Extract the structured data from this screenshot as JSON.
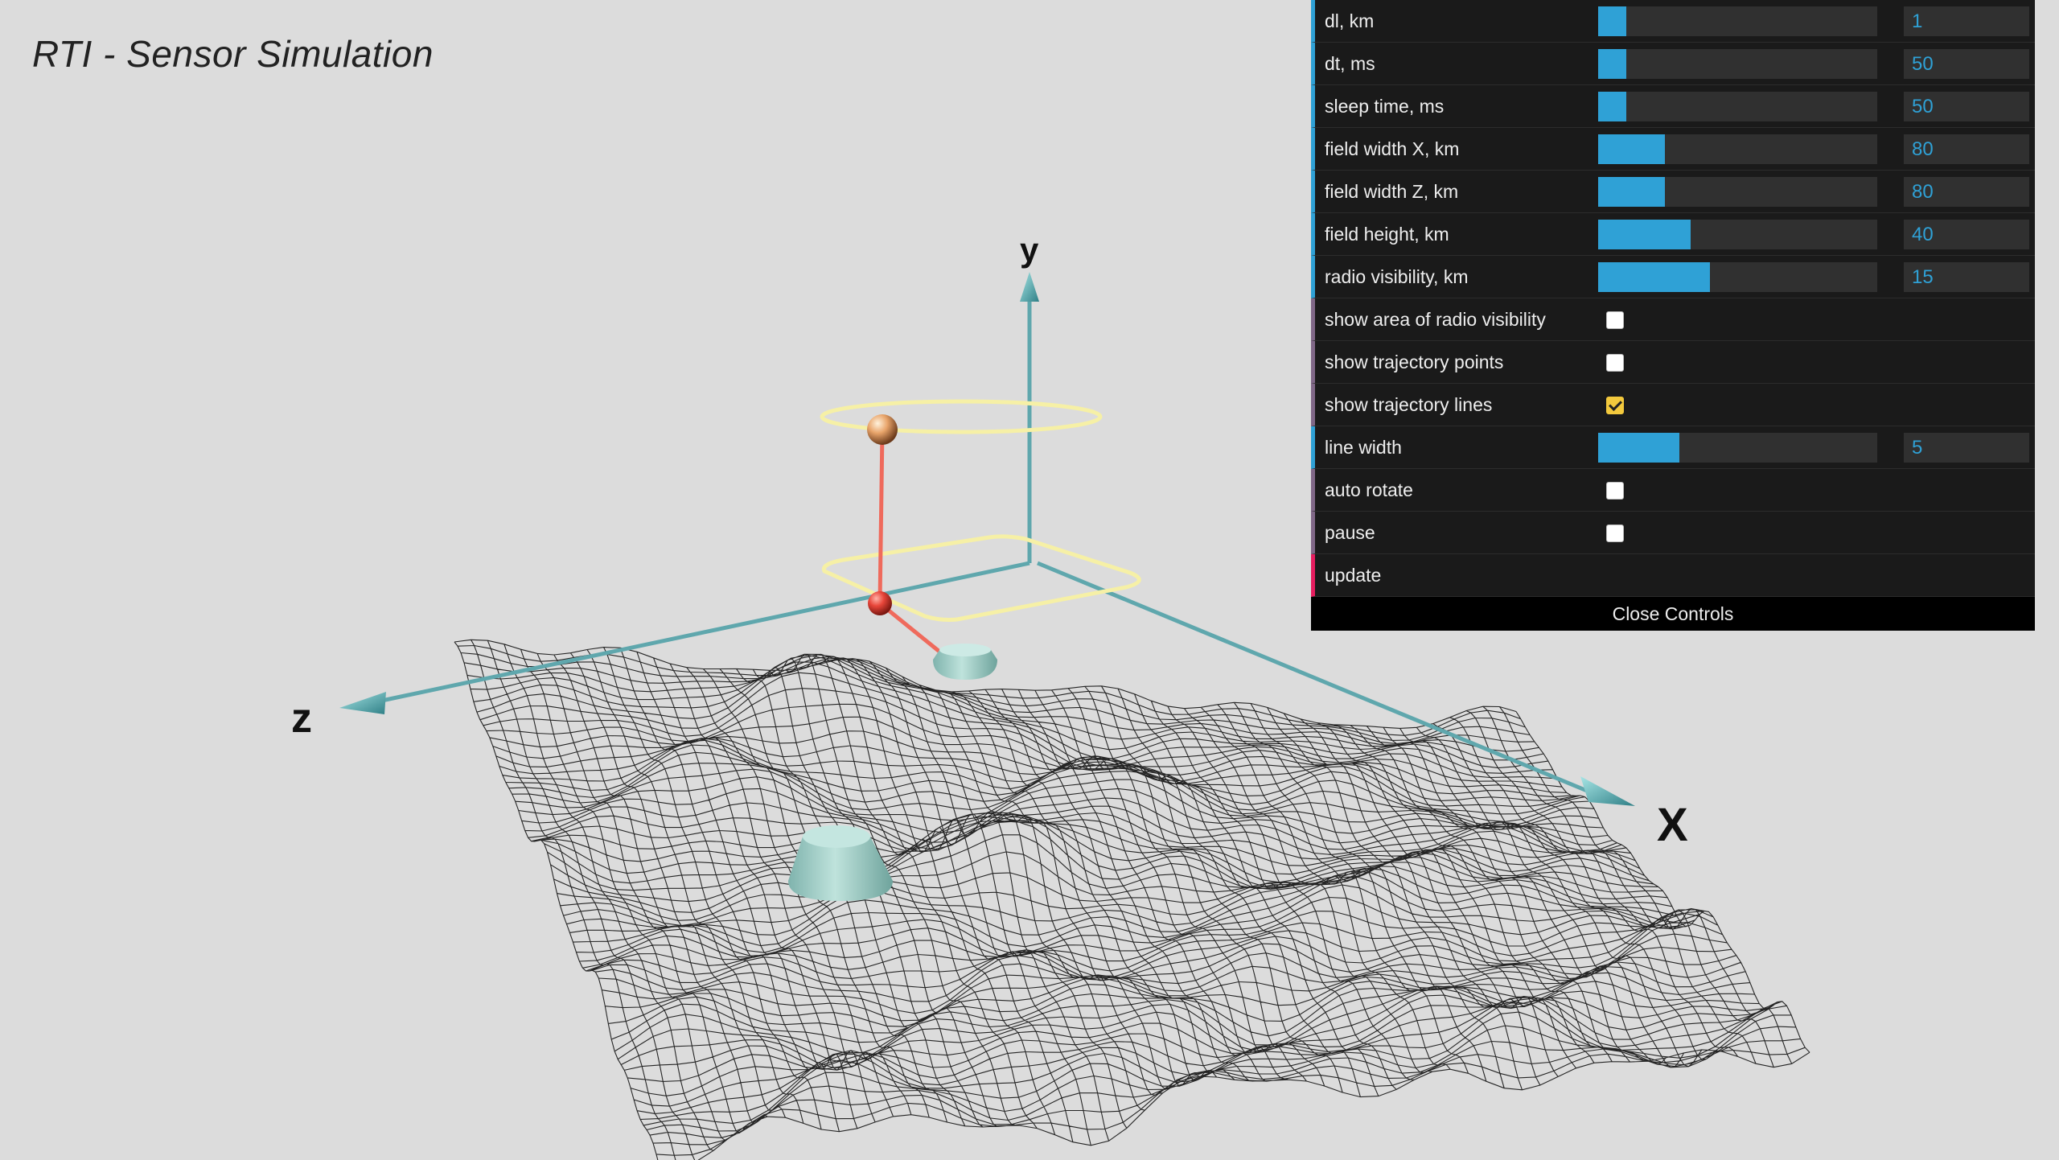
{
  "title": "RTI - Sensor Simulation",
  "axes": {
    "x": "X",
    "y": "y",
    "z": "z"
  },
  "controls": [
    {
      "type": "slider",
      "name": "dl",
      "label": "dl, km",
      "value": "1",
      "fill": 0.1
    },
    {
      "type": "slider",
      "name": "dt",
      "label": "dt, ms",
      "value": "50",
      "fill": 0.1
    },
    {
      "type": "slider",
      "name": "sleep-time",
      "label": "sleep time, ms",
      "value": "50",
      "fill": 0.1
    },
    {
      "type": "slider",
      "name": "field-width-x",
      "label": "field width X, km",
      "value": "80",
      "fill": 0.24
    },
    {
      "type": "slider",
      "name": "field-width-z",
      "label": "field width Z, km",
      "value": "80",
      "fill": 0.24
    },
    {
      "type": "slider",
      "name": "field-height",
      "label": "field height, km",
      "value": "40",
      "fill": 0.33
    },
    {
      "type": "slider",
      "name": "radio-visibility",
      "label": "radio visibility, km",
      "value": "15",
      "fill": 0.4
    },
    {
      "type": "checkbox",
      "name": "show-radio-area",
      "label": "show area of radio visibility",
      "checked": false
    },
    {
      "type": "checkbox",
      "name": "show-trajectory-points",
      "label": "show trajectory points",
      "checked": false
    },
    {
      "type": "checkbox",
      "name": "show-trajectory-lines",
      "label": "show trajectory lines",
      "checked": true
    },
    {
      "type": "slider",
      "name": "line-width",
      "label": "line width",
      "value": "5",
      "fill": 0.29
    },
    {
      "type": "checkbox",
      "name": "auto-rotate",
      "label": "auto rotate",
      "checked": false
    },
    {
      "type": "checkbox",
      "name": "pause",
      "label": "pause",
      "checked": false
    },
    {
      "type": "button",
      "name": "update",
      "label": "update"
    }
  ],
  "close_controls_label": "Close Controls",
  "colors": {
    "background": "#dcdcdc",
    "axis": "#5fa7ad",
    "mesh": "#111111",
    "sensor": "#a6d6cf",
    "ring": "#f6f0a6",
    "trajectory": "#ef6a5c",
    "ground_ball": "#e8463a",
    "air_ball": "#e5a46c",
    "slider_fill": "#2fa1d6",
    "checkbox_checked": "#f3c93d"
  }
}
